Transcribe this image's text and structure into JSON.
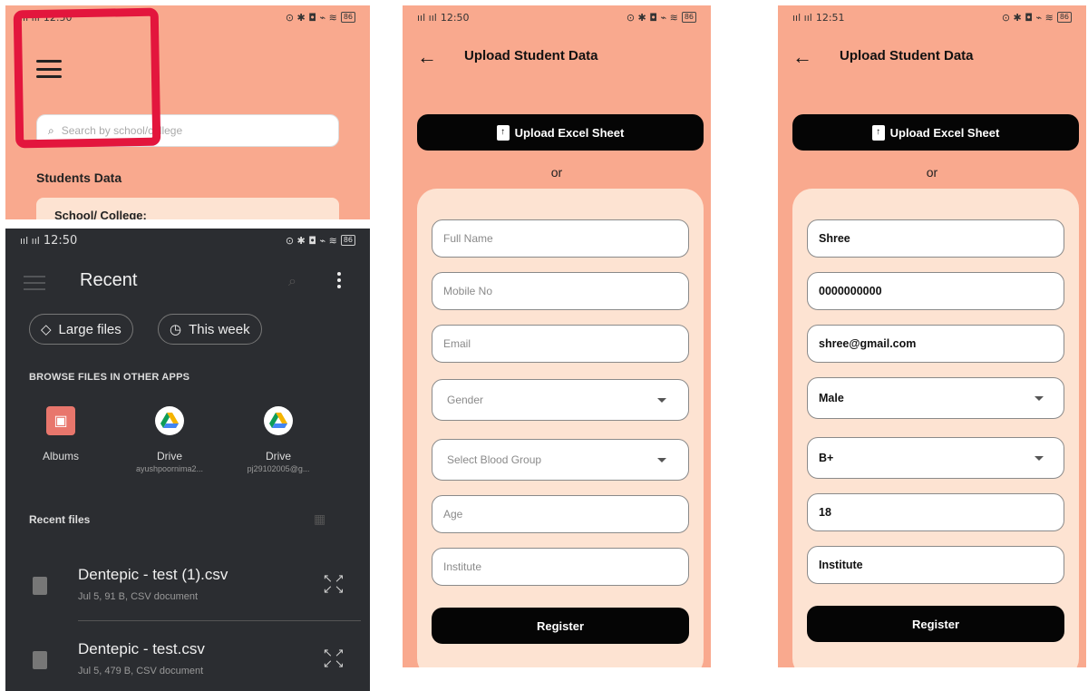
{
  "panel_a": {
    "status": {
      "signal": "ııl ııl",
      "time": "12:50",
      "icons": "⊙ ✱ ◘ ⌁ ≋",
      "battery": "86"
    },
    "search_placeholder": "Search by school/college",
    "section_title": "Students Data",
    "card_label": "School/ College:"
  },
  "panel_b": {
    "status": {
      "signal": "ııl ııl",
      "time": "12:50",
      "icons": "⊙ ✱ ◘ ⌁ ≋",
      "battery": "86"
    },
    "title": "Recent",
    "chips": [
      {
        "label": "Large files",
        "icon": "tag-icon"
      },
      {
        "label": "This week",
        "icon": "clock-icon"
      }
    ],
    "browse_label": "BROWSE FILES IN OTHER APPS",
    "apps": [
      {
        "name": "Albums",
        "sub": "",
        "icon": "albums-icon"
      },
      {
        "name": "Drive",
        "sub": "ayushpoornima2...",
        "icon": "drive-icon"
      },
      {
        "name": "Drive",
        "sub": "pj29102005@g...",
        "icon": "drive-icon"
      }
    ],
    "recent_files_label": "Recent files",
    "files": [
      {
        "name": "Dentepic - test (1).csv",
        "meta": "Jul 5, 91 B, CSV document"
      },
      {
        "name": "Dentepic - test.csv",
        "meta": "Jul 5, 479 B, CSV document"
      }
    ]
  },
  "form_empty": {
    "status": {
      "signal": "ııl ııl",
      "time": "12:50",
      "icons": "⊙ ✱ ◘ ⌁ ≋",
      "battery": "86"
    },
    "title": "Upload Student Data",
    "upload_label": "Upload Excel Sheet",
    "or_label": "or",
    "fields": {
      "full_name": "Full Name",
      "mobile": "Mobile No",
      "email": "Email",
      "gender": "Gender",
      "blood_group": "Select Blood Group",
      "age": "Age",
      "institute": "Institute"
    },
    "register_label": "Register"
  },
  "form_filled": {
    "status": {
      "signal": "ııl ııl",
      "time": "12:51",
      "icons": "⊙ ✱ ◘ ⌁ ≋",
      "battery": "86"
    },
    "title": "Upload Student Data",
    "upload_label": "Upload Excel Sheet",
    "or_label": "or",
    "fields": {
      "full_name": "Shree",
      "mobile": "0000000000",
      "email": "shree@gmail.com",
      "gender": "Male",
      "blood_group": "B+",
      "age": "18",
      "institute": "Institute"
    },
    "register_label": "Register"
  },
  "colors": {
    "app_bg": "#f9a98e",
    "card_bg": "#fde3d2",
    "button": "#050505",
    "highlight": "#e3163d",
    "dark_bg": "#2b2d31"
  }
}
